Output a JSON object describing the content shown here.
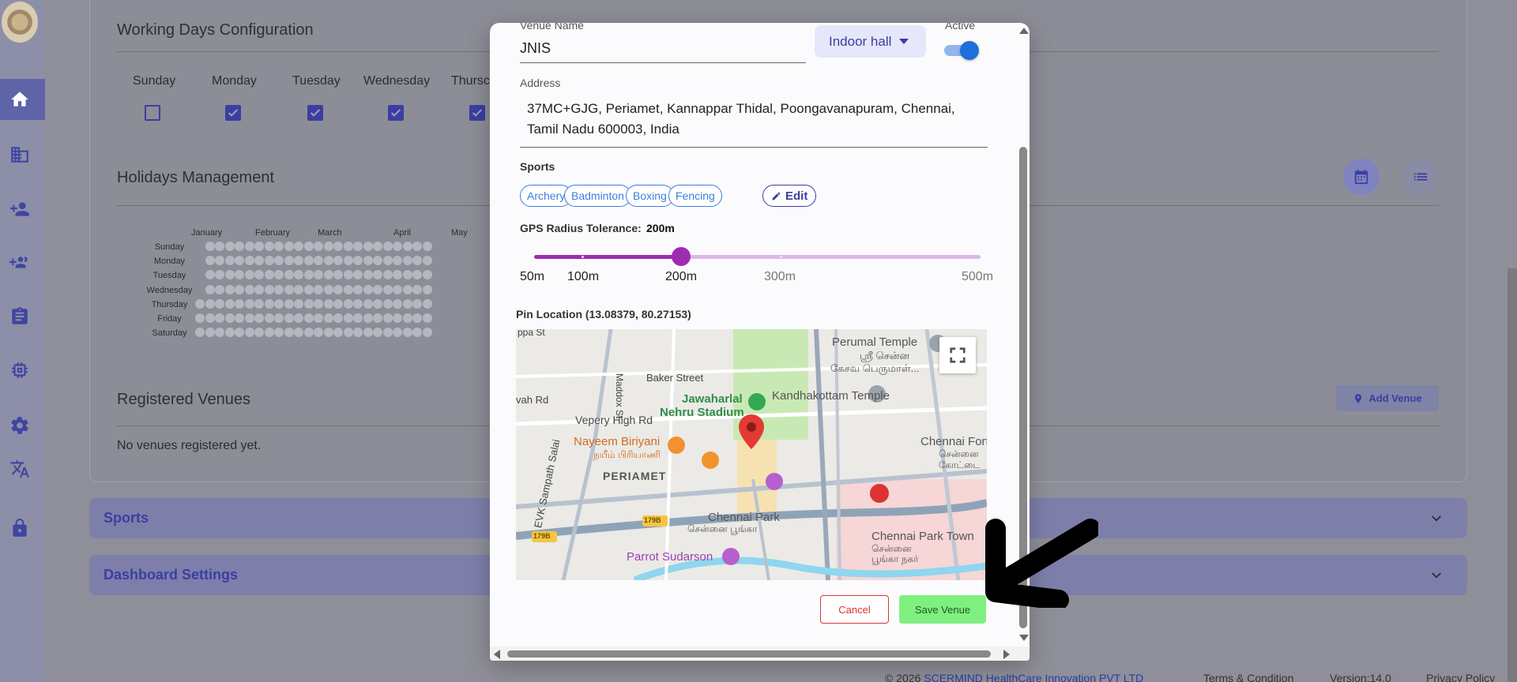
{
  "working_days": {
    "title": "Working Days Configuration",
    "days": [
      {
        "label": "Sunday",
        "checked": false
      },
      {
        "label": "Monday",
        "checked": true
      },
      {
        "label": "Tuesday",
        "checked": true
      },
      {
        "label": "Wednesday",
        "checked": true
      },
      {
        "label": "Thursc",
        "checked": true
      }
    ]
  },
  "holidays": {
    "title": "Holidays Management",
    "months": [
      "January",
      "February",
      "March",
      "April",
      "May"
    ],
    "weekdays": [
      "Sunday",
      "Monday",
      "Tuesday",
      "Wednesday",
      "Thursday",
      "Friday",
      "Saturday"
    ]
  },
  "venues": {
    "title": "Registered Venues",
    "add_label": "Add Venue",
    "empty_text": "No venues registered yet."
  },
  "accordions": {
    "sports": "Sports",
    "dashboard": "Dashboard Settings"
  },
  "footer": {
    "copyright_prefix": "© 2026 ",
    "company": "SCERMIND HealthCare Innovation PVT LTD",
    "terms": "Terms & Condition",
    "version": "Version:14.0",
    "privacy": "Privacy Policy"
  },
  "modal": {
    "venue_name_label": "Venue Name",
    "venue_name_value": "JNIS",
    "venue_type": "Indoor hall",
    "active_label": "Active",
    "active": true,
    "address_label": "Address",
    "address_value": "37MC+GJG, Periamet, Kannappar Thidal, Poongavanapuram, Chennai, Tamil Nadu 600003, India",
    "sports_label": "Sports",
    "sports": [
      "Archery",
      "Badminton",
      "Boxing",
      "Fencing"
    ],
    "edit_label": "Edit",
    "gps_label": "GPS Radius Tolerance:",
    "gps_value": "200m",
    "gps_value_m": 200,
    "gps_marks": [
      "50m",
      "100m",
      "200m",
      "300m",
      "500m"
    ],
    "pin_label": "Pin Location (13.08379, 80.27153)",
    "map_labels": {
      "perumal": "Perumal Temple",
      "perumal_ta": "ஸ்ரீ சென்ன",
      "perumal_ta2": "கேசவ பெருமாள்...",
      "baker": "Baker Street",
      "jnis1": "Jawaharlal",
      "jnis2": "Nehru Stadium",
      "kandha": "Kandhakottam Temple",
      "vepery": "Vepery High Rd",
      "nayeem": "Nayeem Biriyani",
      "nayeem_ta": "நயீம் பிரியாணி",
      "periamet": "PERIAMET",
      "fort": "Chennai Fort",
      "fort_ta": "சென்னை",
      "fort_ta2": "கோட்டை",
      "park": "Chennai Park",
      "park_ta": "சென்னை பூங்கா",
      "park_town": "Chennai Park Town",
      "park_town_ta": "சென்னை",
      "park_town_ta2": "பூங்கா நகர்",
      "parrot": "Parrot Sudarson",
      "evk": "EVK Sampath Salai",
      "road_179b": "179B",
      "maddox": "Maddox St",
      "ammal": "ppa St",
      "evenu": "vah Rd"
    },
    "cancel_label": "Cancel",
    "save_label": "Save Venue"
  },
  "colors": {
    "primary": "#3b3ea1",
    "accent_purple": "#a02bb3",
    "chip_blue": "#3e7ee0",
    "save_green": "#7ff07f",
    "cancel_red": "#dd3333"
  }
}
